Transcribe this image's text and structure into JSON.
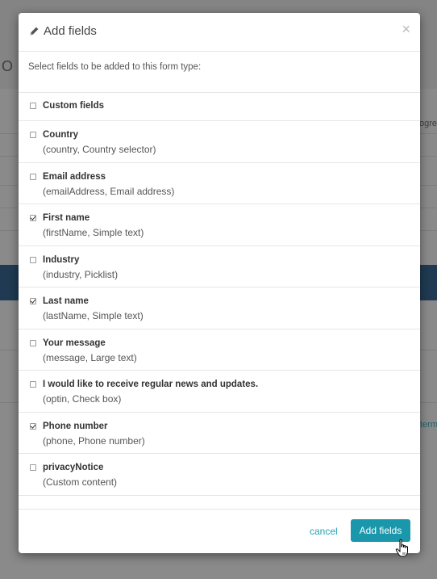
{
  "modal": {
    "title": "Add fields",
    "close_symbol": "×",
    "intro": "Select fields to be added to this form type:",
    "fields": [
      {
        "name": "Custom fields",
        "sub": "",
        "checked": false
      },
      {
        "name": "Country",
        "sub": "(country, Country selector)",
        "checked": false
      },
      {
        "name": "Email address",
        "sub": "(emailAddress, Email address)",
        "checked": false
      },
      {
        "name": "First name",
        "sub": "(firstName, Simple text)",
        "checked": true
      },
      {
        "name": "Industry",
        "sub": "(industry, Picklist)",
        "checked": false
      },
      {
        "name": "Last name",
        "sub": "(lastName, Simple text)",
        "checked": true
      },
      {
        "name": "Your message",
        "sub": "(message, Large text)",
        "checked": false
      },
      {
        "name": "I would like to receive regular news and updates.",
        "sub": "(optin, Check box)",
        "checked": false
      },
      {
        "name": "Phone number",
        "sub": "(phone, Phone number)",
        "checked": true
      },
      {
        "name": "privacyNotice",
        "sub": "(Custom content)",
        "checked": false
      }
    ],
    "cancel_label": "cancel",
    "submit_label": "Add fields"
  },
  "background": {
    "letter": "O",
    "right_text": "ogres",
    "link_text": "term"
  },
  "icons": {
    "title": "pencil-icon",
    "close": "close-icon",
    "cursor": "hand-pointer-icon"
  },
  "colors": {
    "accent": "#1b97ab",
    "link": "#23a1b7",
    "overlay": "#8a8a8a",
    "bg_band": "#1f3a52"
  }
}
